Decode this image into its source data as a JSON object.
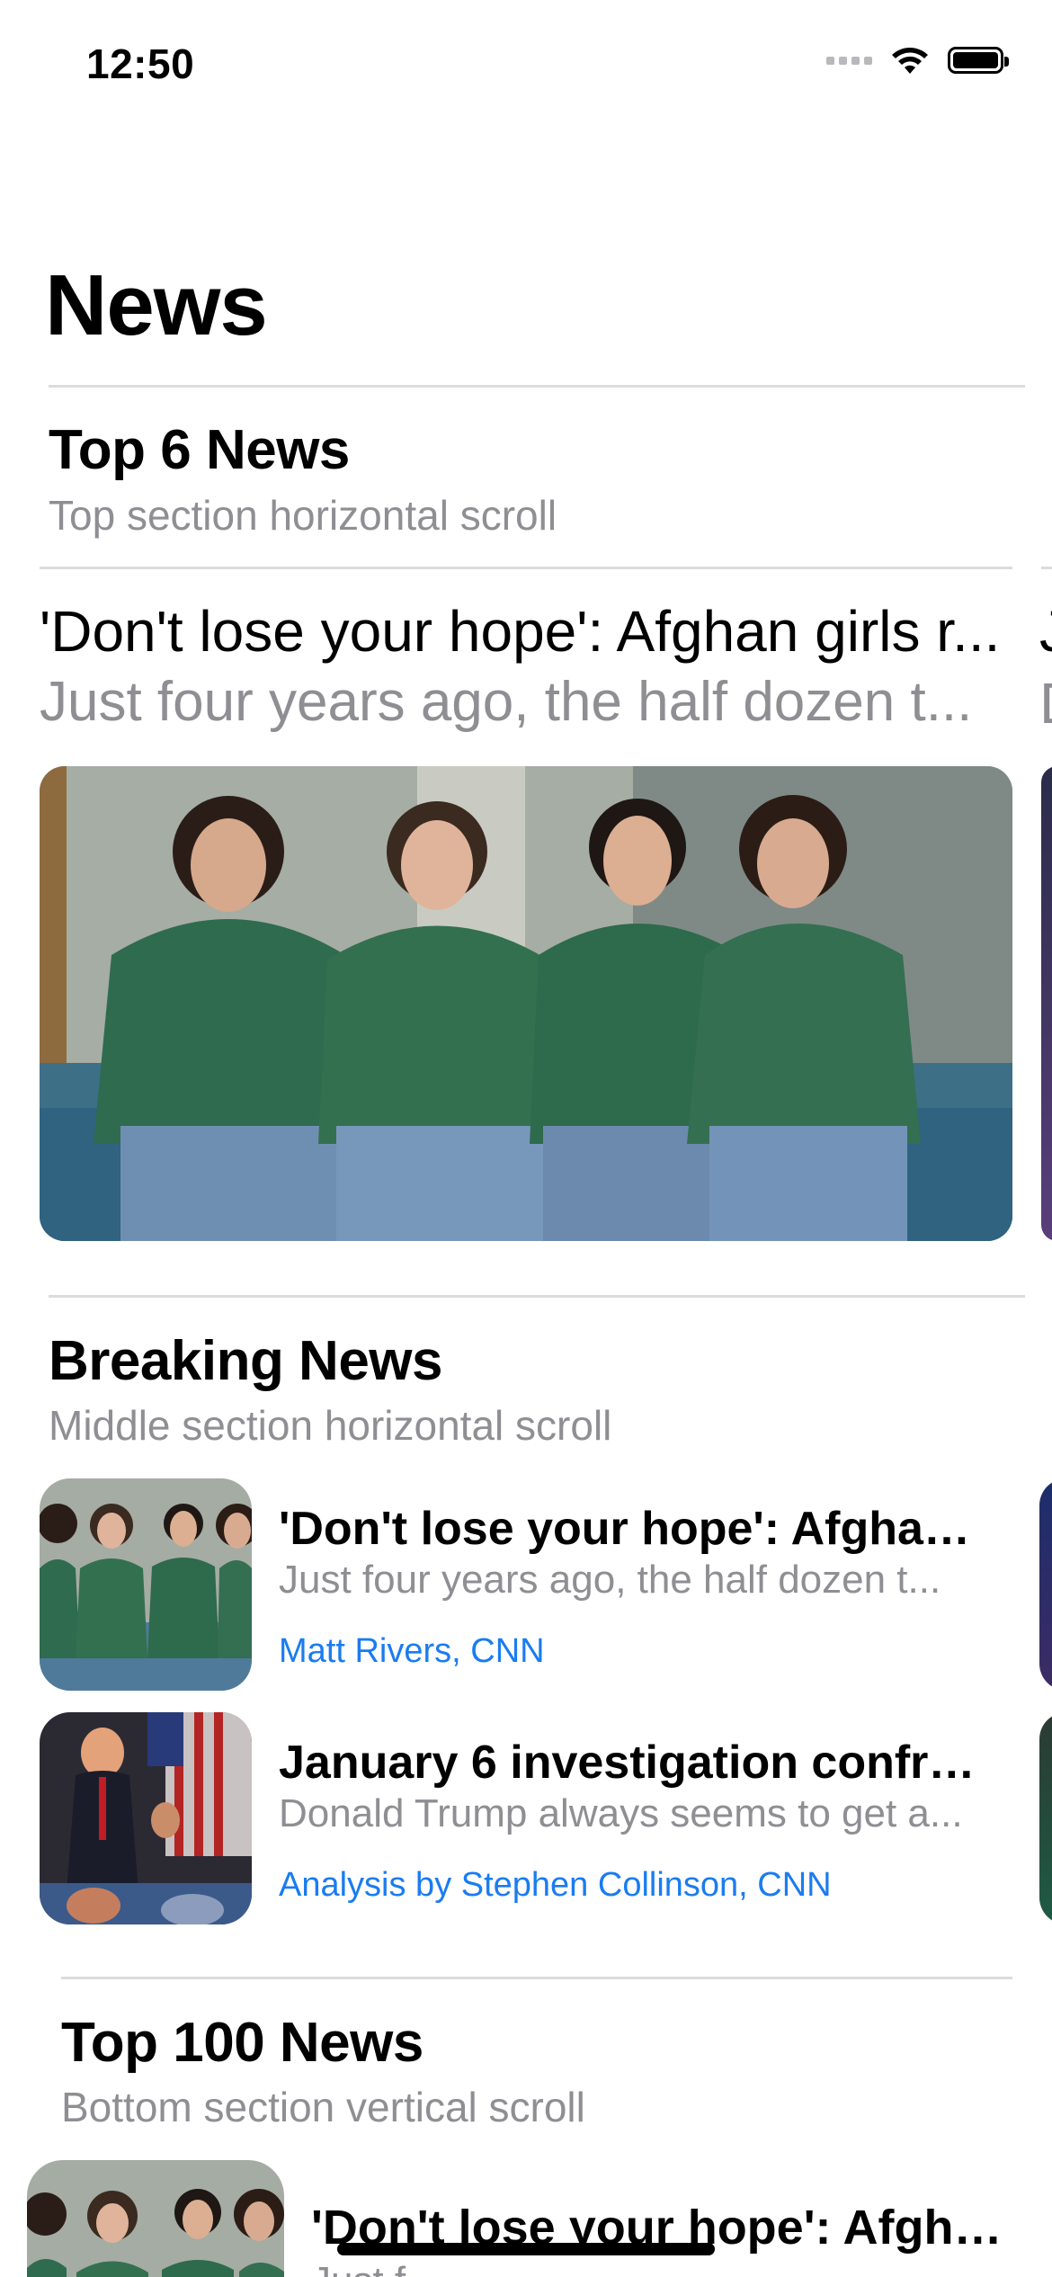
{
  "status_bar": {
    "time": "12:50"
  },
  "page": {
    "title": "News"
  },
  "top_section": {
    "title": "Top 6 News",
    "subtitle": "Top section horizontal scroll",
    "card": {
      "title": "'Don't lose your hope': Afghan girls r...",
      "description": "Just four years ago, the half dozen t..."
    },
    "peek_card": {
      "title_initial": "J",
      "description_initial": "D"
    }
  },
  "breaking_section": {
    "title": "Breaking News",
    "subtitle": "Middle section horizontal scroll",
    "items": [
      {
        "title": "'Don't lose your hope': Afghan...",
        "description": "Just four years ago, the half dozen t...",
        "author": "Matt Rivers, CNN"
      },
      {
        "title": "January 6 investigation confro...",
        "description": "Donald Trump always seems to get a...",
        "author": "Analysis by Stephen Collinson, CNN"
      }
    ]
  },
  "bottom_section": {
    "title": "Top 100 News",
    "subtitle": "Bottom section vertical scroll",
    "items": [
      {
        "title": "'Don't lose your hope': Afghan...",
        "description_fragment": "Just f"
      }
    ]
  },
  "icons": [
    "cellular-signal-icon",
    "wifi-icon",
    "battery-icon"
  ]
}
